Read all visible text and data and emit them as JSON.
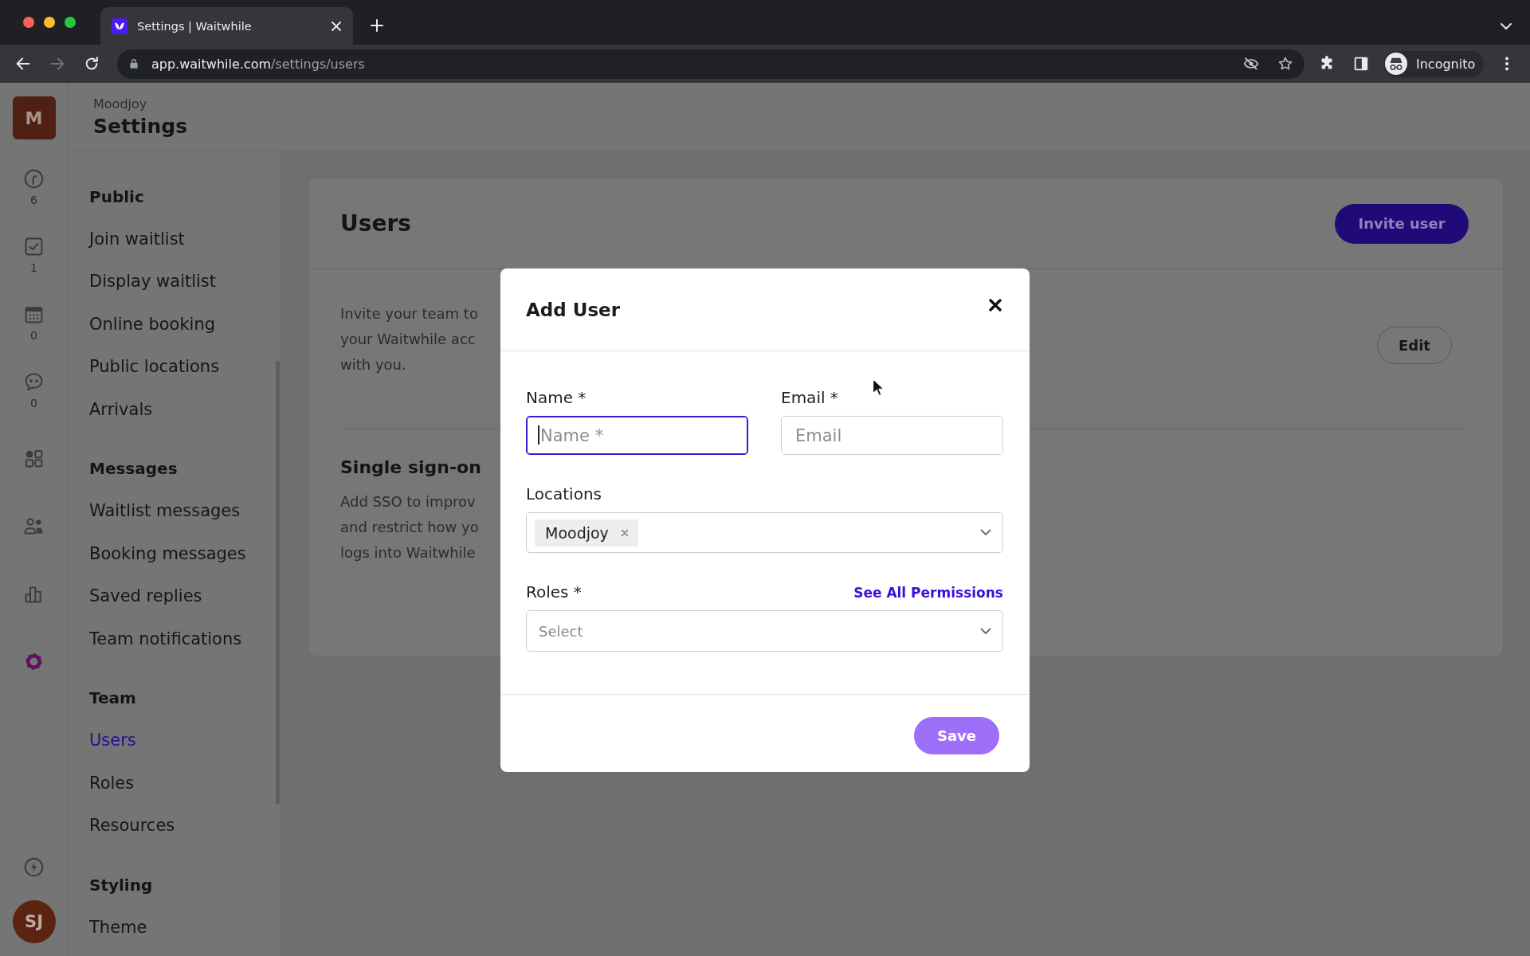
{
  "browser": {
    "tab": {
      "title": "Settings | Waitwhile"
    },
    "address": {
      "host": "app.waitwhile.com",
      "path": "/settings/users"
    },
    "profile": {
      "label": "Incognito"
    }
  },
  "rail": {
    "account": {
      "initial": "M"
    },
    "items": [
      {
        "count": "6",
        "selected": false
      },
      {
        "count": "1",
        "selected": false
      },
      {
        "count": "0",
        "selected": false
      },
      {
        "count": "0",
        "selected": false
      },
      {
        "selected": false
      },
      {
        "selected": false
      },
      {
        "selected": false
      },
      {
        "selected": true
      }
    ],
    "user": {
      "initials": "SJ"
    }
  },
  "header": {
    "organization": "Moodjoy",
    "title": "Settings"
  },
  "sidebar": {
    "groups": [
      {
        "heading": "Public",
        "items": [
          {
            "label": "Join waitlist",
            "selected": false
          },
          {
            "label": "Display waitlist",
            "selected": false
          },
          {
            "label": "Online booking",
            "selected": false
          },
          {
            "label": "Public locations",
            "selected": false
          },
          {
            "label": "Arrivals",
            "selected": false
          }
        ]
      },
      {
        "heading": "Messages",
        "items": [
          {
            "label": "Waitlist messages",
            "selected": false
          },
          {
            "label": "Booking messages",
            "selected": false
          },
          {
            "label": "Saved replies",
            "selected": false
          },
          {
            "label": "Team notifications",
            "selected": false
          }
        ]
      },
      {
        "heading": "Team",
        "items": [
          {
            "label": "Users",
            "selected": true
          },
          {
            "label": "Roles",
            "selected": false
          },
          {
            "label": "Resources",
            "selected": false
          }
        ]
      },
      {
        "heading": "Styling",
        "items": [
          {
            "label": "Theme",
            "selected": false
          }
        ]
      }
    ]
  },
  "users_card": {
    "title": "Users",
    "invite_button": "Invite user",
    "sections": [
      {
        "lines": [
          "Invite your team to",
          "your Waitwhile acc",
          "with you."
        ],
        "action": "Edit"
      },
      {
        "title": "Single sign-on",
        "lines": [
          "Add SSO to improv",
          "and restrict how yo",
          "logs into Waitwhile"
        ]
      }
    ]
  },
  "modal": {
    "title": "Add User",
    "fields": [
      {
        "kind": "text",
        "label": "Name *",
        "placeholder": "Name *",
        "focused": true
      },
      {
        "kind": "text",
        "label": "Email *",
        "placeholder": "Email",
        "focused": false
      },
      {
        "kind": "multiselect",
        "label": "Locations",
        "chips": [
          {
            "label": "Moodjoy"
          }
        ]
      },
      {
        "kind": "select",
        "label": "Roles *",
        "placeholder": "Select",
        "link": "See All Permissions"
      }
    ],
    "save_button": {
      "label": "Save",
      "disabled": true
    }
  }
}
